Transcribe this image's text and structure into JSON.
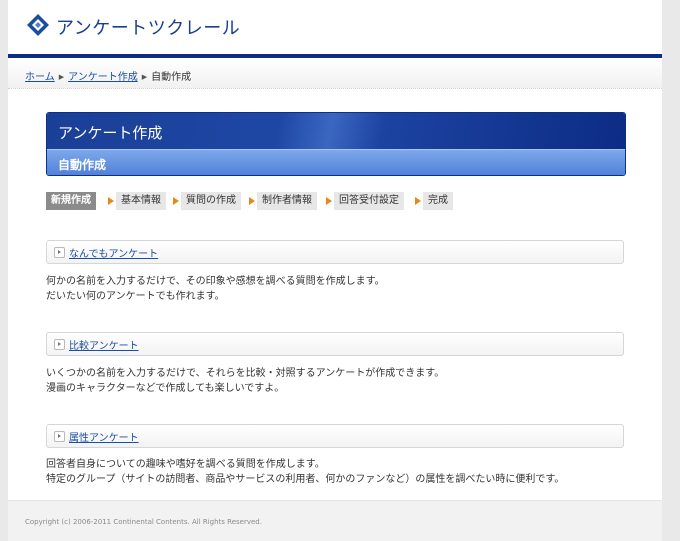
{
  "header": {
    "logo_text": "アンケートツクレール",
    "logo_icon": "diamond-logo-icon"
  },
  "breadcrumb": {
    "items": [
      "ホーム",
      "アンケート作成"
    ],
    "current": "自動作成",
    "separator": "▶"
  },
  "title": {
    "main": "アンケート作成",
    "sub": "自動作成"
  },
  "steps": {
    "items": [
      "新規作成",
      "基本情報",
      "質問の作成",
      "制作者情報",
      "回答受付設定",
      "完成"
    ],
    "active_index": 0
  },
  "sections": [
    {
      "link": "なんでもアンケート",
      "lines": [
        "何かの名前を入力するだけで、その印象や感想を調べる質問を作成します。",
        "だいたい何のアンケートでも作れます。"
      ]
    },
    {
      "link": "比較アンケート",
      "lines": [
        "いくつかの名前を入力するだけで、それらを比較・対照するアンケートが作成できます。",
        "漫画のキャラクターなどで作成しても楽しいですよ。"
      ]
    },
    {
      "link": "属性アンケート",
      "lines": [
        "回答者自身についての趣味や嗜好を調べる質問を作成します。",
        "特定のグループ（サイトの訪問者、商品やサービスの利用者、何かのファンなど）の属性を調べたい時に便利です。"
      ]
    }
  ],
  "footer": {
    "copyright": "Copyright (c) 2006-2011 Continental Contents. All Rights Reserved."
  },
  "colors": {
    "brand": "#0b2c88",
    "link": "#1a4fa0",
    "step_arrow": "#e48a15"
  }
}
